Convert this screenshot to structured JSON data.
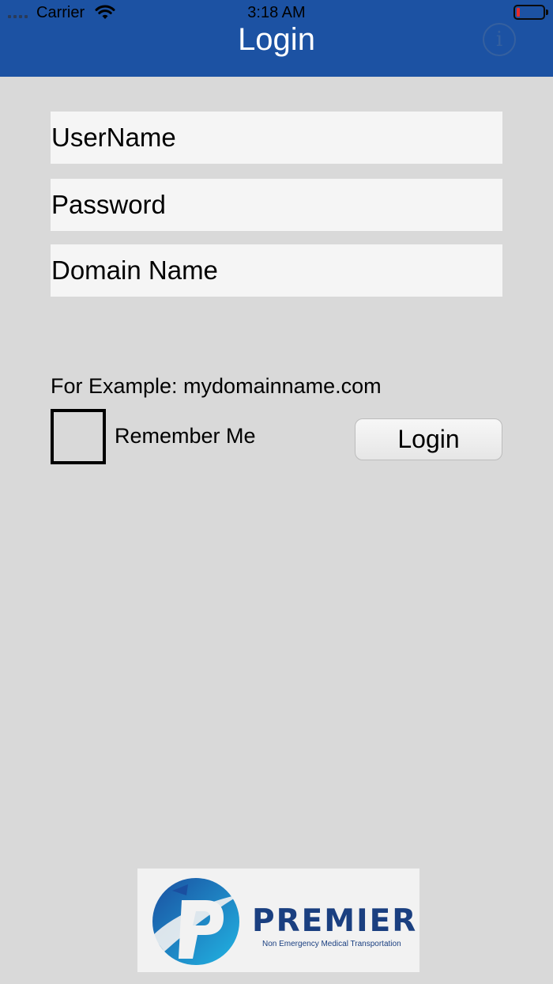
{
  "status_bar": {
    "carrier": "Carrier",
    "time": "3:18 AM",
    "battery_level": 0.1,
    "battery_color": "#e52b2b"
  },
  "nav": {
    "title": "Login",
    "info_icon": "info-icon",
    "bar_color": "#1c52a3"
  },
  "form": {
    "username_placeholder": "UserName",
    "username_value": "",
    "password_placeholder": "Password",
    "password_value": "",
    "domain_placeholder": "Domain Name",
    "domain_value": "",
    "example_text": "For Example: mydomainname.com",
    "remember_label": "Remember Me",
    "remember_checked": false,
    "login_label": "Login"
  },
  "logo": {
    "brand": "PREMIER",
    "tagline": "Non Emergency Medical Transportation",
    "brand_color": "#1a3f80",
    "accent_color": "#1ea0d8"
  }
}
